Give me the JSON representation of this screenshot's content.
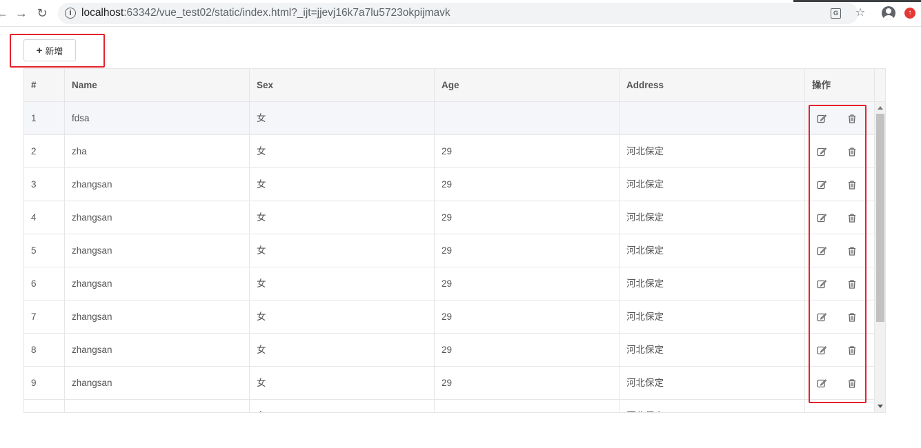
{
  "browser": {
    "url_host": "localhost",
    "url_rest": ":63342/vue_test02/static/index.html?_ijt=jjevj16k7a7lu5723okpijmavk"
  },
  "toolbar": {
    "add_label": "新增"
  },
  "table": {
    "columns": [
      "#",
      "Name",
      "Sex",
      "Age",
      "Address",
      "操作"
    ],
    "rows": [
      [
        "1",
        "fdsa",
        "女",
        "",
        ""
      ],
      [
        "2",
        "zha",
        "女",
        "29",
        "河北保定"
      ],
      [
        "3",
        "zhangsan",
        "女",
        "29",
        "河北保定"
      ],
      [
        "4",
        "zhangsan",
        "女",
        "29",
        "河北保定"
      ],
      [
        "5",
        "zhangsan",
        "女",
        "29",
        "河北保定"
      ],
      [
        "6",
        "zhangsan",
        "女",
        "29",
        "河北保定"
      ],
      [
        "7",
        "zhangsan",
        "女",
        "29",
        "河北保定"
      ],
      [
        "8",
        "zhangsan",
        "女",
        "29",
        "河北保定"
      ],
      [
        "9",
        "zhangsan",
        "女",
        "29",
        "河北保定"
      ],
      [
        "",
        "",
        "女",
        "",
        "河北保定"
      ]
    ]
  },
  "colors": {
    "highlight_box": "#e6212a",
    "header_bg": "#f6f6f6"
  }
}
